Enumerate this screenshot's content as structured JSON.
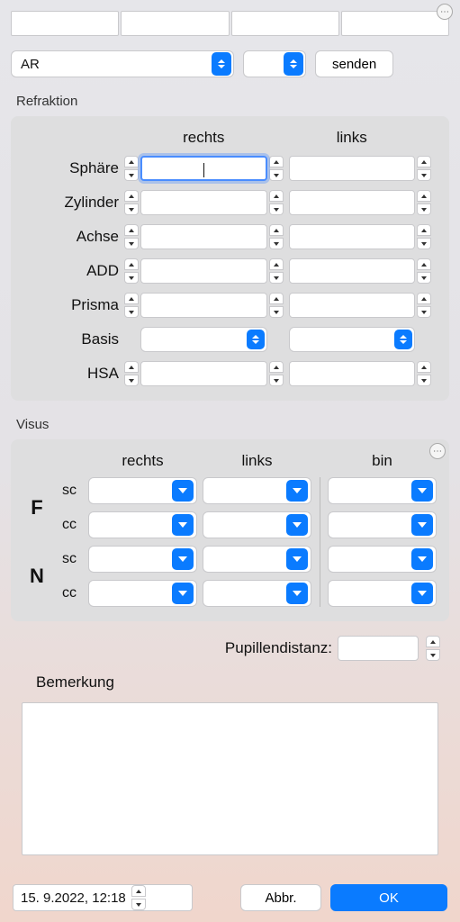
{
  "top": {
    "device_value": "AR",
    "port_value": "",
    "send_label": "senden"
  },
  "refraktion": {
    "title": "Refraktion",
    "col_right": "rechts",
    "col_left": "links",
    "rows": {
      "sphere": "Sphäre",
      "cylinder": "Zylinder",
      "axis": "Achse",
      "add": "ADD",
      "prisma": "Prisma",
      "basis": "Basis",
      "hsa": "HSA"
    },
    "values": {
      "sphere": {
        "r": "",
        "l": ""
      },
      "cylinder": {
        "r": "",
        "l": ""
      },
      "axis": {
        "r": "",
        "l": ""
      },
      "add": {
        "r": "",
        "l": ""
      },
      "prisma": {
        "r": "",
        "l": ""
      },
      "basis": {
        "r": "",
        "l": ""
      },
      "hsa": {
        "r": "",
        "l": ""
      }
    }
  },
  "visus": {
    "title": "Visus",
    "col_r": "rechts",
    "col_l": "links",
    "col_b": "bin",
    "F": "F",
    "N": "N",
    "sc": "sc",
    "cc": "cc",
    "values": {
      "F_sc": {
        "r": "",
        "l": "",
        "b": ""
      },
      "F_cc": {
        "r": "",
        "l": "",
        "b": ""
      },
      "N_sc": {
        "r": "",
        "l": "",
        "b": ""
      },
      "N_cc": {
        "r": "",
        "l": "",
        "b": ""
      }
    }
  },
  "pupil": {
    "label": "Pupillendistanz:",
    "value": ""
  },
  "bemerkung": {
    "label": "Bemerkung",
    "value": ""
  },
  "footer": {
    "datetime": "15.  9.2022, 12:18",
    "cancel": "Abbr.",
    "ok": "OK"
  }
}
